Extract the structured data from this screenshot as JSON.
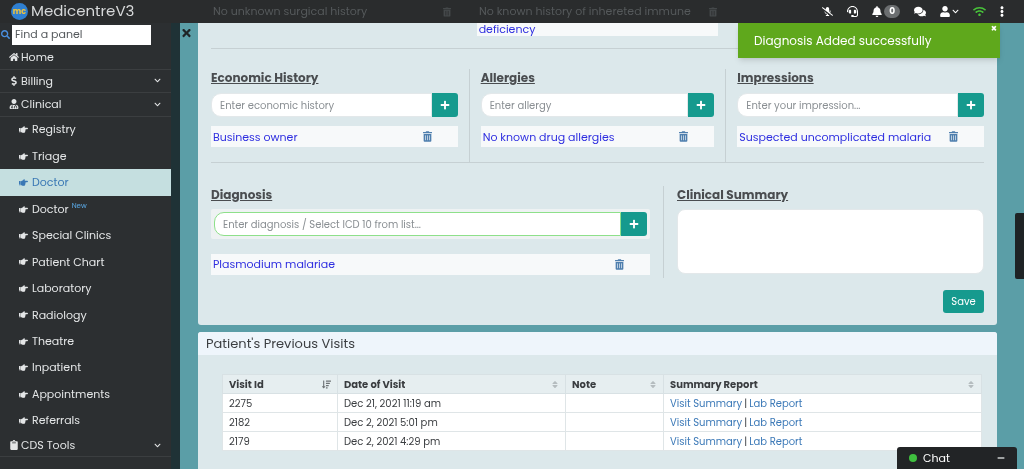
{
  "header": {
    "app_name": "MedicentreV3",
    "logo_text": "mc",
    "background_texts": [
      "No unknown surgical history",
      "No known history of inhereted immune"
    ],
    "notification_count": "0"
  },
  "toast": {
    "message": "Diagnosis Added successfully",
    "close": "×"
  },
  "sidebar": {
    "search_placeholder": "Find a panel",
    "items": [
      {
        "kind": "link",
        "label": "Home"
      },
      {
        "kind": "group",
        "label": "Billing"
      },
      {
        "kind": "group",
        "label": "Clinical",
        "children": [
          {
            "label": "Registry",
            "selected": false
          },
          {
            "label": "Triage",
            "selected": false
          },
          {
            "label": "Doctor",
            "selected": true
          },
          {
            "label": "Doctor",
            "selected": false,
            "badge": "New"
          },
          {
            "label": "Special Clinics",
            "selected": false
          },
          {
            "label": "Patient Chart",
            "selected": false
          },
          {
            "label": "Laboratory",
            "selected": false
          },
          {
            "label": "Radiology",
            "selected": false
          },
          {
            "label": "Theatre",
            "selected": false
          },
          {
            "label": "Inpatient",
            "selected": false
          },
          {
            "label": "Appointments",
            "selected": false
          },
          {
            "label": "Referrals",
            "selected": false
          }
        ]
      },
      {
        "kind": "group",
        "label": "CDS Tools"
      }
    ]
  },
  "history_top": {
    "entry": "deficiency"
  },
  "panels": [
    {
      "title": "Economic History",
      "placeholder": "Enter economic history",
      "entries": [
        "Business owner"
      ]
    },
    {
      "title": "Allergies",
      "placeholder": "Enter allergy",
      "entries": [
        "No known drug allergies"
      ]
    },
    {
      "title": "Impressions",
      "placeholder": "Enter your impression...",
      "entries": [
        "Suspected uncomplicated malaria"
      ]
    }
  ],
  "diagnosis": {
    "title": "Diagnosis",
    "placeholder": "Enter diagnosis / Select ICD 10 from list...",
    "focused": true,
    "entries": [
      "Plasmodium malariae"
    ]
  },
  "clinical_summary": {
    "title": "Clinical Summary"
  },
  "save_button": "Save",
  "visits": {
    "title": "Patient's Previous Visits",
    "columns": [
      {
        "label": "Visit Id",
        "sorted": true
      },
      {
        "label": "Date of Visit",
        "sorted": false
      },
      {
        "label": "Note",
        "sorted": false
      },
      {
        "label": "Summary Report",
        "sorted": false
      }
    ],
    "rows": [
      {
        "visit_id": "2275",
        "date": "Dec 21, 2021 11:19 am",
        "links": [
          "Visit Summary",
          "Lab Report"
        ],
        "separator": "|"
      },
      {
        "visit_id": "2182",
        "date": "Dec 2, 2021 5:01 pm",
        "links": [
          "Visit Summary",
          "Lab Report"
        ],
        "separator": "|"
      },
      {
        "visit_id": "2179",
        "date": "Dec 2, 2021 4:29 pm",
        "links": [
          "Visit Summary",
          "Lab Report"
        ],
        "separator": "|"
      }
    ]
  },
  "chat": {
    "label": "Chat",
    "online": true
  }
}
